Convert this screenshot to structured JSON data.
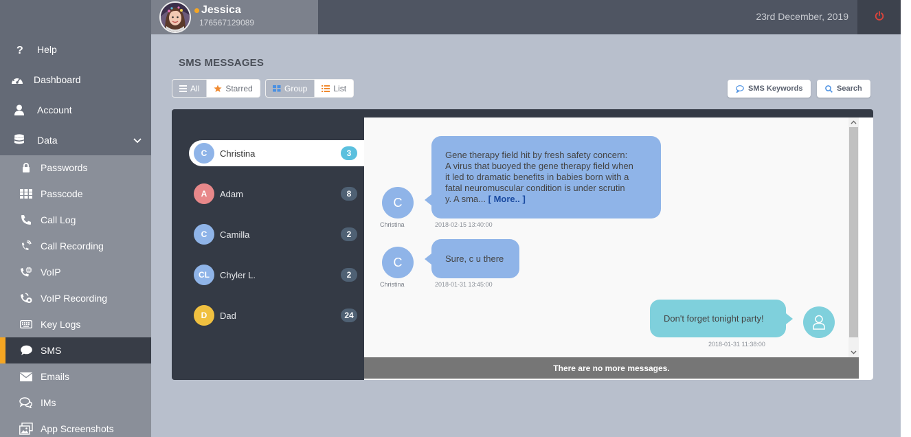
{
  "header": {
    "user_name": "Jessica",
    "user_id": "176567129089",
    "date": "23rd December, 2019"
  },
  "colors": {
    "accent": "#f5a623",
    "sidebar": "#646a76",
    "sidebar_sub": "#8a8f99",
    "header": "#4f5562",
    "main_bg": "#b8bfcc",
    "power": "#e0433a"
  },
  "sidebar": {
    "items": [
      {
        "label": "Help",
        "icon": "question-icon"
      },
      {
        "label": "Dashboard",
        "icon": "dashboard-gauge-icon"
      },
      {
        "label": "Account",
        "icon": "user-icon"
      },
      {
        "label": "Data",
        "icon": "database-icon",
        "expanded": true
      }
    ],
    "sub_items": [
      {
        "label": "Passwords",
        "icon": "lock-icon"
      },
      {
        "label": "Passcode",
        "icon": "keypad-icon"
      },
      {
        "label": "Call Log",
        "icon": "phone-icon"
      },
      {
        "label": "Call Recording",
        "icon": "call-recording-icon"
      },
      {
        "label": "VoIP",
        "icon": "voip-icon"
      },
      {
        "label": "VoIP Recording",
        "icon": "voip-recording-icon"
      },
      {
        "label": "Key Logs",
        "icon": "keyboard-icon"
      },
      {
        "label": "SMS",
        "icon": "chat-bubble-icon",
        "active": true
      },
      {
        "label": "Emails",
        "icon": "envelope-icon"
      },
      {
        "label": "IMs",
        "icon": "messages-icon"
      },
      {
        "label": "App Screenshots",
        "icon": "screenshot-icon"
      }
    ]
  },
  "main": {
    "title": "SMS MESSAGES",
    "filter": {
      "all": "All",
      "starred": "Starred",
      "selected": "All"
    },
    "view": {
      "group": "Group",
      "list": "List",
      "selected": "Group"
    },
    "sms_keywords": "SMS Keywords",
    "search": "Search"
  },
  "contacts": [
    {
      "initials": "C",
      "name": "Christina",
      "count": "3",
      "color": "#8fb4e8",
      "selected": true
    },
    {
      "initials": "A",
      "name": "Adam",
      "count": "8",
      "color": "#e8888a"
    },
    {
      "initials": "C",
      "name": "Camilla",
      "count": "2",
      "color": "#8fb4e8"
    },
    {
      "initials": "CL",
      "name": "Chyler L.",
      "count": "2",
      "color": "#8fb4e8"
    },
    {
      "initials": "D",
      "name": "Dad",
      "count": "24",
      "color": "#f0c040"
    }
  ],
  "messages": [
    {
      "direction": "in",
      "sender": "Christina",
      "initial": "C",
      "lines": [
        "Gene therapy field hit by fresh safety concern:",
        "A virus that buoyed the gene therapy field when",
        "it led to dramatic benefits in babies born with a",
        "fatal neuromuscular condition is under scrutin",
        "y. A sma..."
      ],
      "more": "[ More.. ]",
      "time": "2018-02-15 13:40:00"
    },
    {
      "direction": "in",
      "sender": "Christina",
      "initial": "C",
      "text": "Sure, c u there",
      "time": "2018-01-31 13:45:00"
    },
    {
      "direction": "out",
      "text": "Don't forget tonight party!",
      "time": "2018-01-31 11:38:00"
    }
  ],
  "footer_note": "There are no more messages."
}
